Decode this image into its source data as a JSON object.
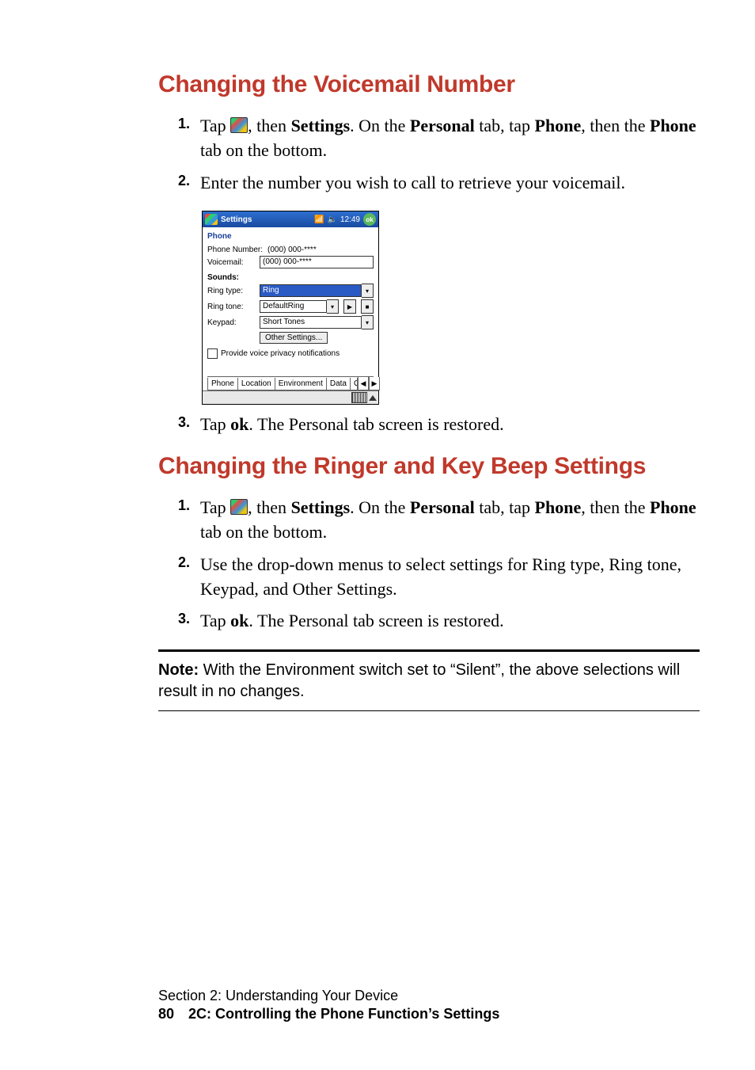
{
  "headings": {
    "h1": "Changing the Voicemail Number",
    "h2": "Changing the Ringer and Key Beep Settings"
  },
  "section1": {
    "steps": [
      {
        "num": "1.",
        "pre": "Tap ",
        "mid1": ", then ",
        "settings": "Settings",
        "mid2": ". On the ",
        "personal": "Personal",
        "mid3": " tab, tap ",
        "phone1": "Phone",
        "mid4": ", then the ",
        "phone2": "Phone",
        "tail": " tab on the bottom."
      },
      {
        "num": "2.",
        "text": "Enter the number you wish to call to retrieve your voicemail."
      },
      {
        "num": "3.",
        "pre": "Tap ",
        "ok": "ok",
        "tail": ". The Personal tab screen is restored."
      }
    ]
  },
  "section2": {
    "steps": [
      {
        "num": "1.",
        "pre": "Tap ",
        "mid1": ", then ",
        "settings": "Settings",
        "mid2": ". On the ",
        "personal": "Personal",
        "mid3": " tab, tap ",
        "phone1": "Phone",
        "mid4": ", then the ",
        "phone2": "Phone",
        "tail": " tab on the bottom."
      },
      {
        "num": "2.",
        "text": "Use the drop-down menus to select settings for Ring type, Ring tone, Keypad, and Other Settings."
      },
      {
        "num": "3.",
        "pre": "Tap ",
        "ok": "ok",
        "tail": ". The Personal tab screen is restored."
      }
    ]
  },
  "note": {
    "label": "Note:",
    "text": " With the Environment switch set to “Silent”, the above selections will result in no changes."
  },
  "footer": {
    "section": "Section 2: Understanding Your Device",
    "page": "80",
    "chapter": "2C: Controlling the Phone Function’s Settings"
  },
  "device": {
    "titlebar": {
      "title": "Settings",
      "clock": "12:49",
      "ok": "ok",
      "signal": "▼█▌",
      "vol": "◄│"
    },
    "subtitle": "Phone",
    "phoneNumberLabel": "Phone Number:",
    "phoneNumberValue": "(000) 000-****",
    "voicemailLabel": "Voicemail:",
    "voicemailValue": "(000) 000-****",
    "soundsLabel": "Sounds:",
    "ringTypeLabel": "Ring type:",
    "ringTypeValue": "Ring",
    "ringToneLabel": "Ring tone:",
    "ringToneValue": "DefaultRing",
    "keypadLabel": "Keypad:",
    "keypadValue": "Short Tones",
    "otherSettings": "Other Settings...",
    "privacyLabel": "Provide voice privacy notifications",
    "tabs": {
      "phone": "Phone",
      "location": "Location",
      "environment": "Environment",
      "data": "Data",
      "other": "Ot"
    }
  }
}
